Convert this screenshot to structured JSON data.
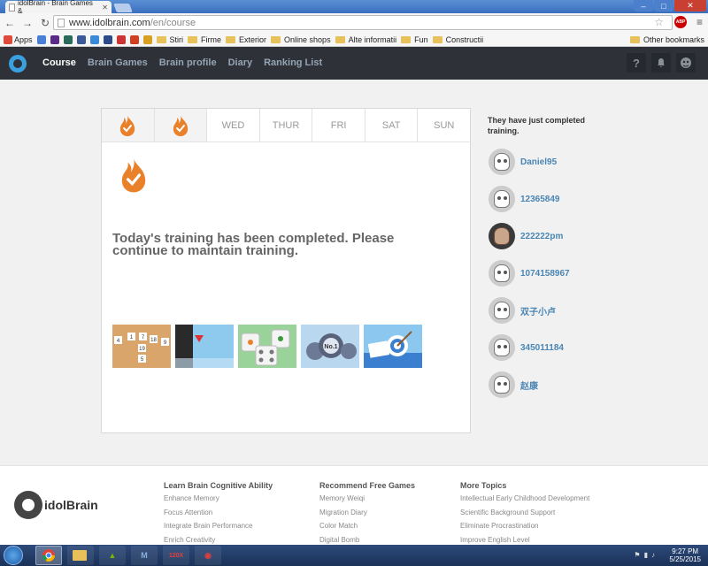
{
  "browser": {
    "tab_title": "idolBrain - Brain Games &",
    "url_domain": "www.idolbrain.com",
    "url_path": "/en/course",
    "abp": "ABP",
    "bookmarks": [
      "Apps",
      "Stiri",
      "Firme",
      "Exterior",
      "Online shops",
      "Alte informatii",
      "Fun",
      "Constructii"
    ],
    "other_bookmarks": "Other bookmarks"
  },
  "nav": {
    "items": [
      {
        "label": "Course",
        "active": true
      },
      {
        "label": "Brain Games",
        "active": false
      },
      {
        "label": "Brain profile",
        "active": false
      },
      {
        "label": "Diary",
        "active": false
      },
      {
        "label": "Ranking List",
        "active": false
      }
    ],
    "help_icon": "?"
  },
  "week": {
    "days": [
      {
        "label": "",
        "done": true
      },
      {
        "label": "",
        "done": true
      },
      {
        "label": "WED",
        "done": false
      },
      {
        "label": "THUR",
        "done": false
      },
      {
        "label": "FRI",
        "done": false
      },
      {
        "label": "SAT",
        "done": false
      },
      {
        "label": "SUN",
        "done": false
      }
    ]
  },
  "main": {
    "message": "Today's training has been completed. Please continue to maintain training.",
    "games": [
      "number-grid-game",
      "direction-game",
      "dice-color-game",
      "gear-number-game",
      "target-game"
    ],
    "game_labels": {
      "grid_numbers": [
        "4",
        "1",
        "7",
        "18",
        "9",
        "19",
        "5"
      ],
      "gear_text": "No.1"
    }
  },
  "side": {
    "title": "They have just completed training.",
    "users": [
      {
        "name": "Daniel95",
        "photo": false
      },
      {
        "name": "12365849",
        "photo": false
      },
      {
        "name": "222222pm",
        "photo": true
      },
      {
        "name": "1074158967",
        "photo": false
      },
      {
        "name": "双子小卢",
        "photo": false
      },
      {
        "name": "345011184",
        "photo": false
      },
      {
        "name": "赵康",
        "photo": false
      }
    ]
  },
  "footer": {
    "logo_text": "idolBrain",
    "columns": [
      {
        "title": "Learn Brain Cognitive Ability",
        "links": [
          "Enhance Memory",
          "Focus Attention",
          "Integrate Brain Performance",
          "Enrich Creativity"
        ]
      },
      {
        "title": "Recommend Free Games",
        "links": [
          "Memory Weiqi",
          "Migration Diary",
          "Color Match",
          "Digital Bomb"
        ]
      },
      {
        "title": "More Topics",
        "links": [
          "Intellectual Early Childhood Development",
          "Scientific Background Support",
          "Eliminate Procrastination",
          "Improve English Level"
        ]
      }
    ]
  },
  "taskbar": {
    "time": "9:27 PM",
    "date": "5/25/2015",
    "apps": [
      "chrome",
      "explorer",
      "nvidia",
      "maxthon",
      "120x",
      "browser"
    ]
  },
  "colors": {
    "nav_bg": "#2e3238",
    "flame": "#e8812a",
    "user_link": "#4a86b4"
  }
}
